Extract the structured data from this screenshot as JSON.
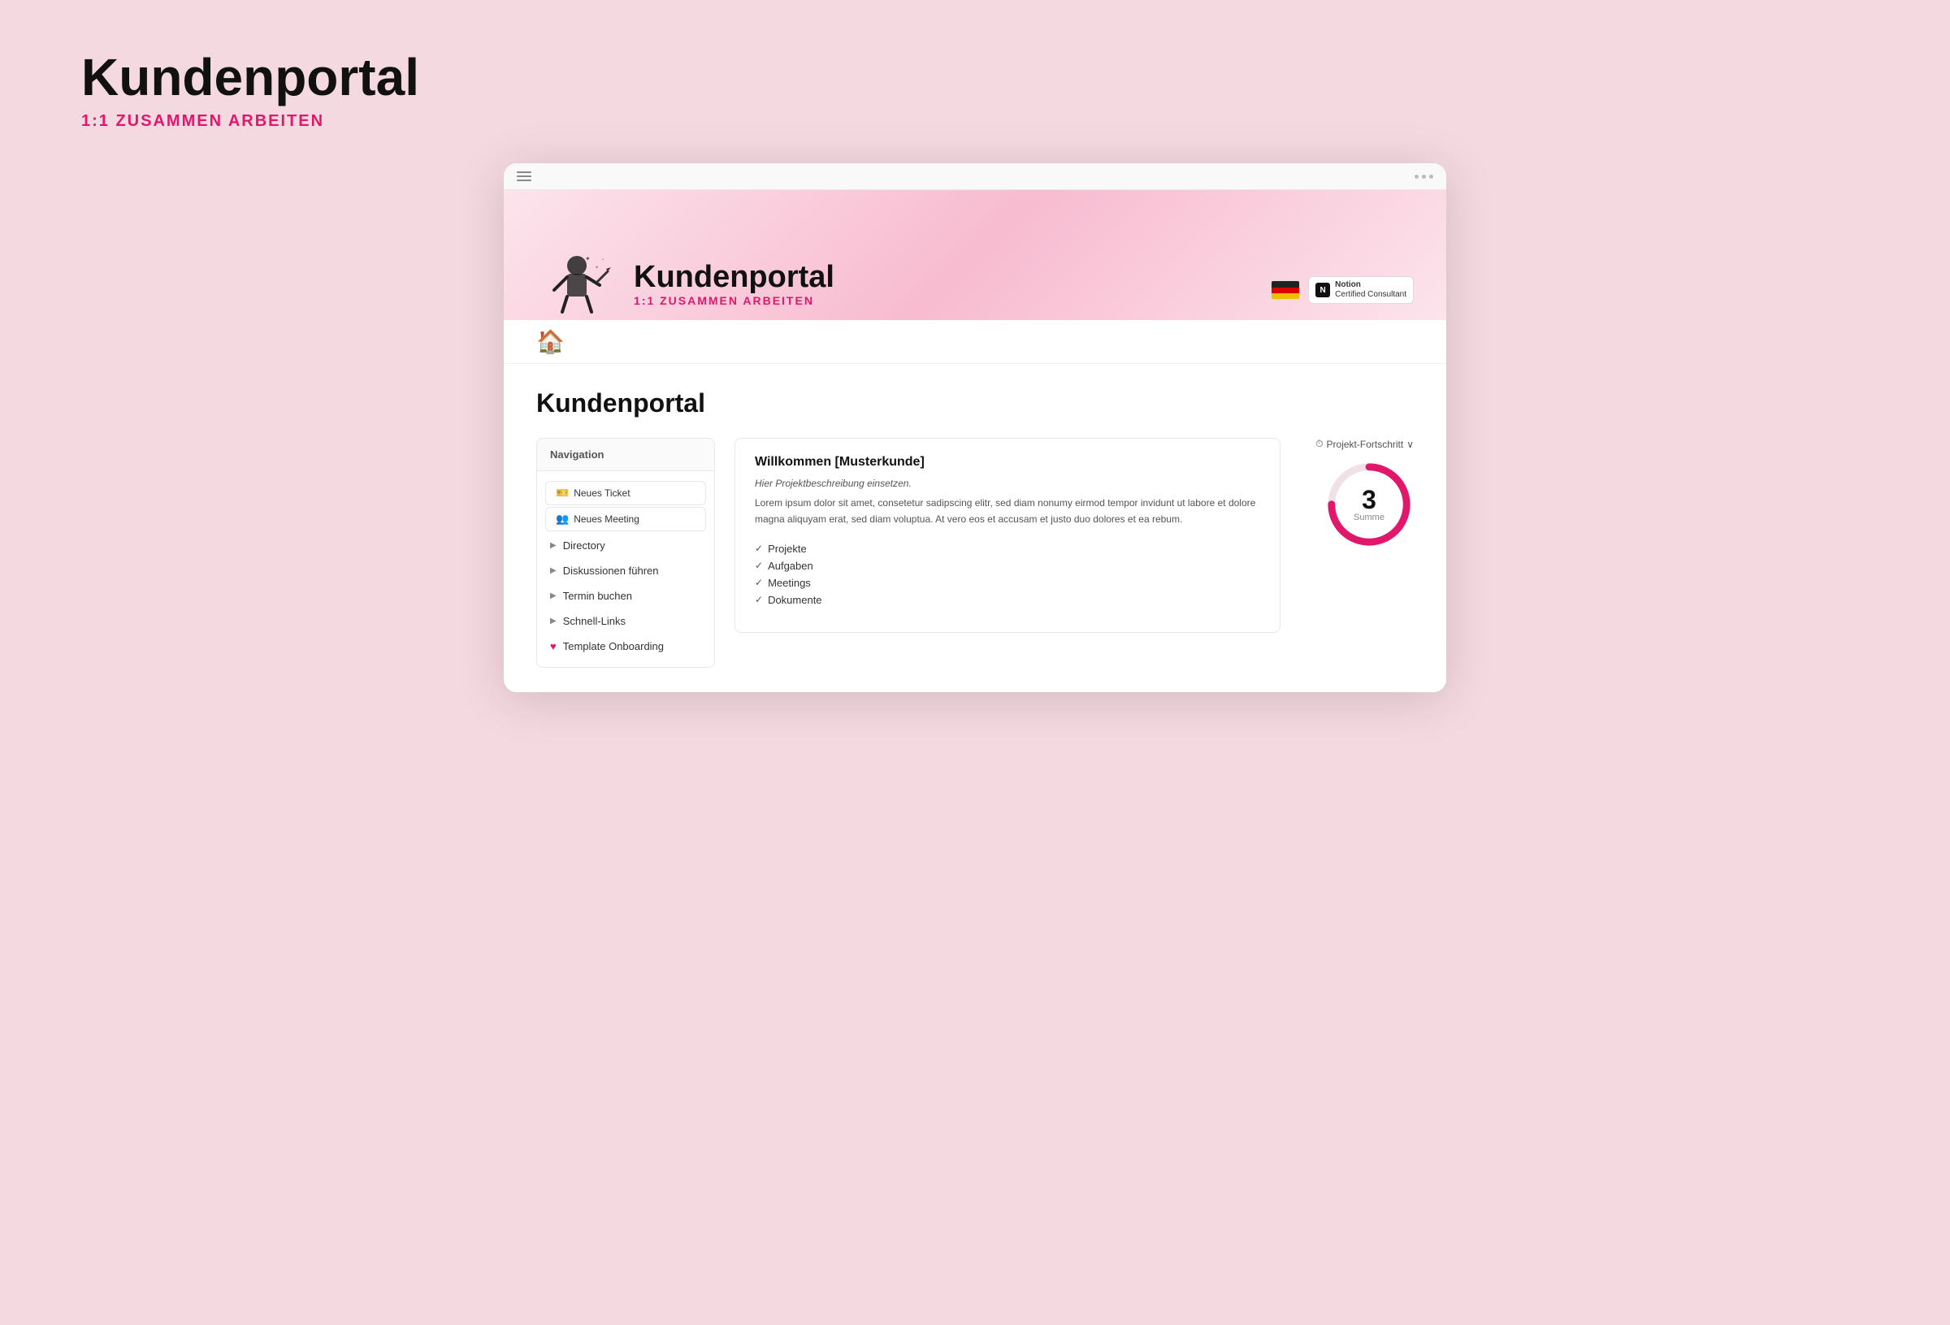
{
  "page": {
    "main_title": "Kundenportal",
    "subtitle": "1:1 ZUSAMMEN ARBEITEN",
    "bg_color": "#f5d9e0"
  },
  "browser": {
    "menu_label": "menu",
    "dots_label": "options"
  },
  "banner": {
    "title": "Kundenportal",
    "subtitle": "1:1 ZUSAMMEN ARBEITEN",
    "notion_badge_title": "Notion",
    "notion_badge_subtitle": "Certified Consultant"
  },
  "content": {
    "page_title": "Kundenportal"
  },
  "navigation": {
    "header": "Navigation",
    "items": [
      {
        "id": "neues-ticket",
        "label": "Neues Ticket",
        "type": "button",
        "icon": "🎫"
      },
      {
        "id": "neues-meeting",
        "label": "Neues Meeting",
        "type": "button",
        "icon": "👥"
      },
      {
        "id": "directory",
        "label": "Directory",
        "type": "arrow",
        "icon": "▶"
      },
      {
        "id": "diskussionen",
        "label": "Diskussionen führen",
        "type": "arrow",
        "icon": "▶"
      },
      {
        "id": "termin",
        "label": "Termin buchen",
        "type": "arrow",
        "icon": "▶"
      },
      {
        "id": "schnell-links",
        "label": "Schnell-Links",
        "type": "arrow",
        "icon": "▶"
      },
      {
        "id": "template",
        "label": "Template Onboarding",
        "type": "heart",
        "icon": "♥"
      }
    ]
  },
  "welcome": {
    "title": "Willkommen [Musterkunde]",
    "desc": "Hier Projektbeschreibung einsetzen.",
    "body": "Lorem ipsum dolor sit amet, consetetur sadipscing elitr, sed diam nonumy eirmod tempor invidunt ut labore et dolore magna aliquyam erat, sed diam voluptua. At vero eos et accusam et justo duo dolores et ea rebum.",
    "checklist": [
      "Projekte",
      "Aufgaben",
      "Meetings",
      "Dokumente"
    ]
  },
  "progress": {
    "header_label": "Projekt-Fortschritt",
    "chevron": "∨",
    "number": "3",
    "label": "Summe",
    "clock_icon": "⏱",
    "percent": 75
  }
}
